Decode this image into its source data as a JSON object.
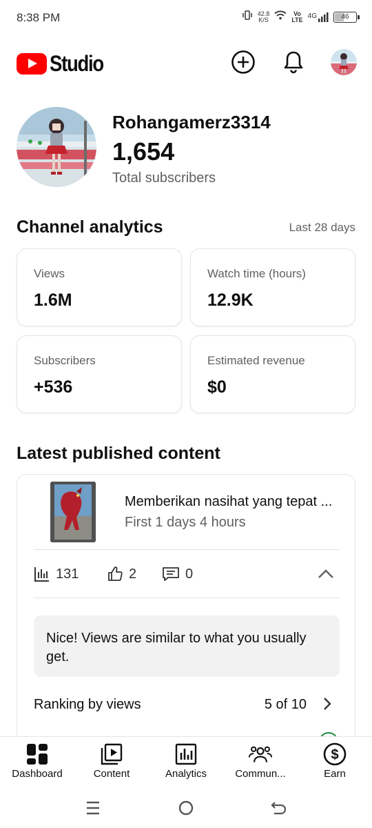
{
  "status_bar": {
    "time": "8:38 PM",
    "net_speed_value": "42.8",
    "net_speed_unit": "K/S",
    "volte_top": "Vo",
    "volte_bottom": "LTE",
    "network": "4G",
    "battery": "46",
    "battery_level": 0.46
  },
  "app_bar": {
    "logo_text": "Studio",
    "icons": [
      "create-icon",
      "bell-icon",
      "account-avatar"
    ]
  },
  "channel": {
    "name": "Rohangamerz3314",
    "subscriber_count": "1,654",
    "subscriber_label": "Total subscribers"
  },
  "analytics": {
    "title": "Channel analytics",
    "range": "Last 28 days",
    "cards": [
      {
        "label": "Views",
        "value": "1.6M"
      },
      {
        "label": "Watch time (hours)",
        "value": "12.9K"
      },
      {
        "label": "Subscribers",
        "value": "+536"
      },
      {
        "label": "Estimated revenue",
        "value": "$0"
      }
    ]
  },
  "latest": {
    "title": "Latest published content",
    "video_title": "Memberikan nasihat yang tepat ...",
    "video_subtitle": "First 1 days 4 hours",
    "stats": {
      "views": "131",
      "likes": "2",
      "comments": "0"
    },
    "insight": "Nice! Views are similar to what you usually get.",
    "ranking_label": "Ranking by views",
    "ranking_value": "5 of 10"
  },
  "bottom_nav": [
    {
      "label": "Dashboard",
      "icon": "dashboard-icon"
    },
    {
      "label": "Content",
      "icon": "content-icon"
    },
    {
      "label": "Analytics",
      "icon": "analytics-icon"
    },
    {
      "label": "Commun...",
      "icon": "community-icon"
    },
    {
      "label": "Earn",
      "icon": "earn-icon"
    }
  ],
  "colors": {
    "brand_red": "#ff0000",
    "text": "#0f0f0f",
    "secondary": "#606060",
    "accent_green": "#1e8e3e"
  }
}
